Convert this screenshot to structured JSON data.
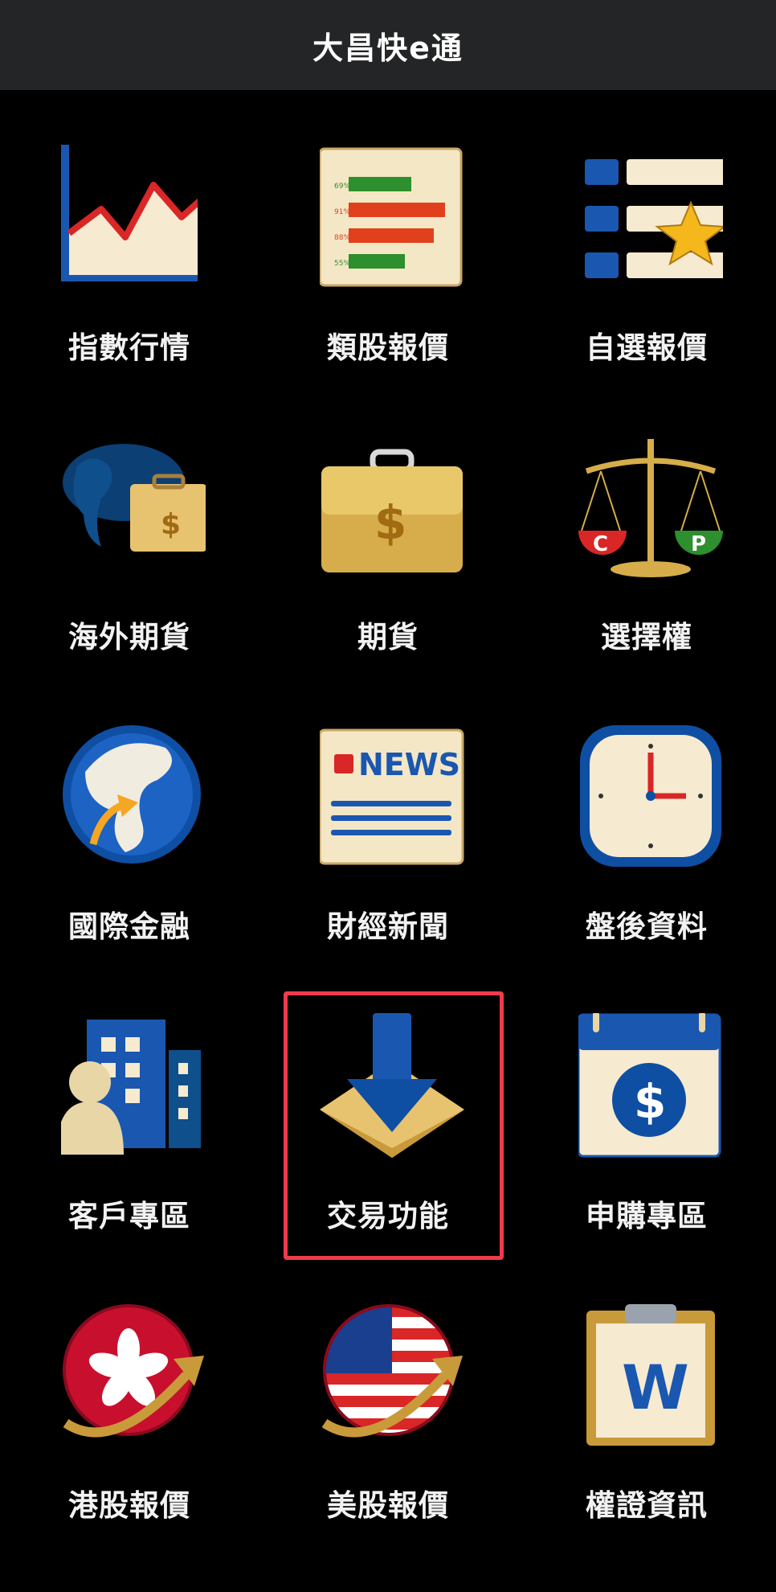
{
  "header": {
    "title": "大昌快e通"
  },
  "menu": {
    "items": [
      {
        "label": "指數行情",
        "icon": "line-chart-icon"
      },
      {
        "label": "類股報價",
        "icon": "bar-list-icon"
      },
      {
        "label": "自選報價",
        "icon": "starred-list-icon"
      },
      {
        "label": "海外期貨",
        "icon": "globe-briefcase-icon"
      },
      {
        "label": "期貨",
        "icon": "briefcase-icon"
      },
      {
        "label": "選擇權",
        "icon": "scale-icon"
      },
      {
        "label": "國際金融",
        "icon": "globe-icon"
      },
      {
        "label": "財經新聞",
        "icon": "news-icon"
      },
      {
        "label": "盤後資料",
        "icon": "clock-icon"
      },
      {
        "label": "客戶專區",
        "icon": "customer-building-icon"
      },
      {
        "label": "交易功能",
        "icon": "download-arrow-icon"
      },
      {
        "label": "申購專區",
        "icon": "calendar-dollar-icon"
      },
      {
        "label": "港股報價",
        "icon": "hong-kong-flag-icon"
      },
      {
        "label": "美股報價",
        "icon": "us-flag-icon"
      },
      {
        "label": "權證資訊",
        "icon": "clipboard-w-icon"
      }
    ],
    "highlighted_index": 10
  },
  "icon_text": {
    "bar_percents": [
      "69%",
      "91%",
      "88%",
      "55%"
    ],
    "news_word": "NEWS",
    "call": "C",
    "put": "P",
    "dollar": "$",
    "warrant": "W"
  },
  "colors": {
    "background": "#000000",
    "header": "#242526",
    "highlight": "#ef3b4c",
    "icon_blue": "#0e4fa3",
    "icon_cream": "#f6ead0",
    "icon_gold": "#d6ad4a",
    "icon_red": "#d92626",
    "icon_green": "#2d8f2d"
  }
}
